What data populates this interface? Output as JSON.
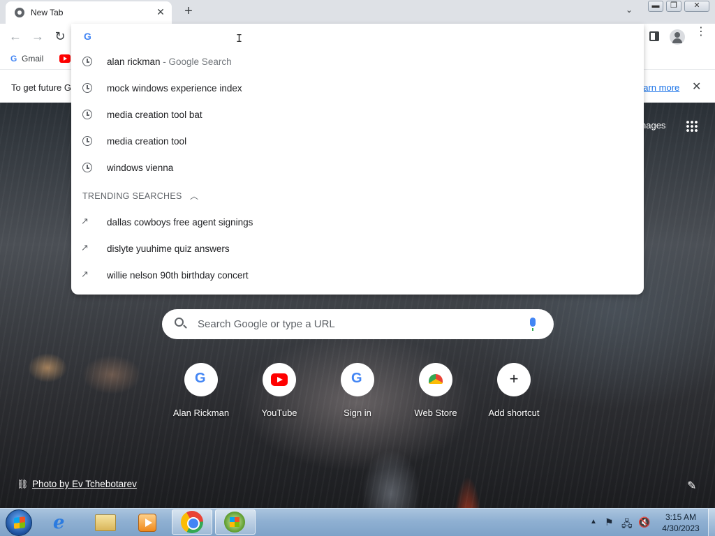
{
  "browser": {
    "tab_title": "New Tab",
    "tab_close": "✕",
    "new_tab": "+",
    "tab_search": "⌄",
    "window_minimize": "▬",
    "window_maximize": "❐",
    "window_close": "✕"
  },
  "toolbar": {
    "back": "←",
    "forward": "→",
    "reload": "↻",
    "menu": "⋮"
  },
  "bookmarks": {
    "gmail_label": "Gmail"
  },
  "infobar": {
    "message": "To get future G",
    "learn_more": "earn more",
    "close": "✕"
  },
  "omnibox": {
    "value": "",
    "suggestions": [
      {
        "text": "alan rickman",
        "suffix": " - Google Search",
        "icon": "history-icon"
      },
      {
        "text": "mock windows experience index",
        "icon": "history-icon"
      },
      {
        "text": "media creation tool bat",
        "icon": "history-icon"
      },
      {
        "text": "media creation tool",
        "icon": "history-icon"
      },
      {
        "text": "windows vienna",
        "icon": "history-icon"
      }
    ],
    "trending_header": "TRENDING SEARCHES",
    "trending": [
      {
        "text": "dallas cowboys free agent signings",
        "icon": "trending-icon"
      },
      {
        "text": "dislyte yuuhime quiz answers",
        "icon": "trending-icon"
      },
      {
        "text": "willie nelson 90th birthday concert",
        "icon": "trending-icon"
      }
    ]
  },
  "ntp": {
    "images_link": "nages",
    "search_placeholder": "Search Google or type a URL",
    "shortcuts": [
      {
        "label": "Alan Rickman",
        "icon": "google-icon"
      },
      {
        "label": "YouTube",
        "icon": "youtube-icon"
      },
      {
        "label": "Sign in",
        "icon": "google-icon"
      },
      {
        "label": "Web Store",
        "icon": "web-store-icon"
      },
      {
        "label": "Add shortcut",
        "icon": "plus-icon"
      }
    ],
    "photo_credit": "Photo by Ev Tchebotarev",
    "customize_icon": "✎"
  },
  "taskbar": {
    "time": "3:15 AM",
    "date": "4/30/2023"
  },
  "colors": {
    "accent": "#1a73e8",
    "google_blue": "#4285f4",
    "youtube_red": "#ff0000"
  }
}
